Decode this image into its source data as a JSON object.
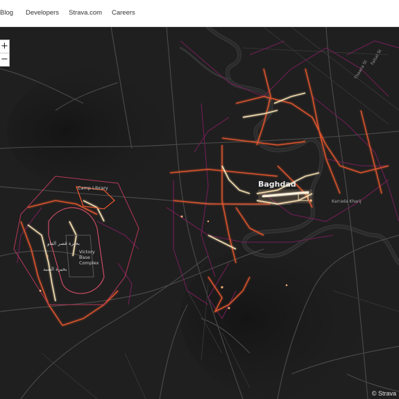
{
  "nav": {
    "items": [
      {
        "label": "Blog"
      },
      {
        "label": "Developers"
      },
      {
        "label": "Strava.com"
      },
      {
        "label": "Careers"
      }
    ]
  },
  "map": {
    "zoom_in": "+",
    "zoom_out": "−",
    "attribution": "© Strava",
    "labels": {
      "city": "Baghdad",
      "camp_library": "Camp Library",
      "victory_base": "Victory Base Complex",
      "arabic_1": "بحيرة قصر الفاو",
      "arabic_2": "بحيرة الصيد",
      "karrada": "Karrada Kharij",
      "street_1": "Thawra St",
      "street_2": "Falsal St"
    },
    "colors": {
      "background": "#1e1e1e",
      "heat_low": "#7a1f5c",
      "heat_mid": "#e4572e",
      "heat_high": "#ffe7b8",
      "road": "#4a4a4a",
      "river": "#2d2d2d"
    }
  }
}
